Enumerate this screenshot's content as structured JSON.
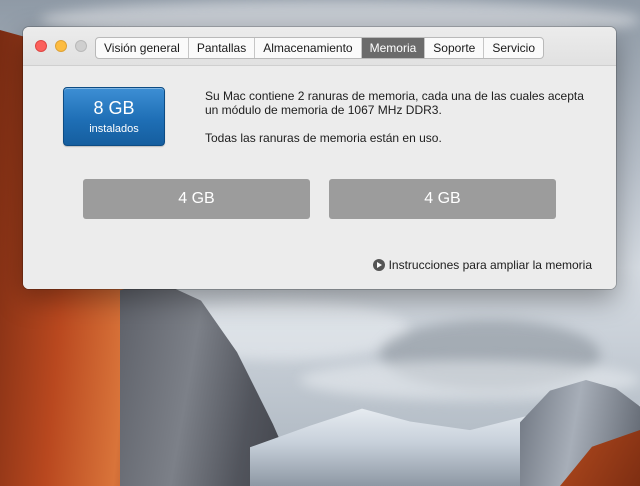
{
  "window": {
    "tabs": [
      {
        "label": "Visión general",
        "active": false
      },
      {
        "label": "Pantallas",
        "active": false
      },
      {
        "label": "Almacenamiento",
        "active": false
      },
      {
        "label": "Memoria",
        "active": true
      },
      {
        "label": "Soporte",
        "active": false
      },
      {
        "label": "Servicio",
        "active": false
      }
    ]
  },
  "memory": {
    "total_size": "8 GB",
    "total_label": "instalados",
    "description_1": "Su Mac contiene 2 ranuras de memoria, cada una de las cuales acepta un módulo de memoria de 1067 MHz DDR3.",
    "description_2": "Todas las ranuras de memoria están en uso.",
    "slots": [
      {
        "label": "4 GB"
      },
      {
        "label": "4 GB"
      }
    ],
    "upgrade_link": "Instrucciones para ampliar la memoria",
    "upgrade_icon": "arrow-circle-icon"
  },
  "colors": {
    "accent": "#1f6fb6",
    "active_tab": "#6b6b6b",
    "slot": "#9c9c9c",
    "close": "#fc605c",
    "minimize": "#fdbc40",
    "zoom": "#cfcfcf"
  }
}
